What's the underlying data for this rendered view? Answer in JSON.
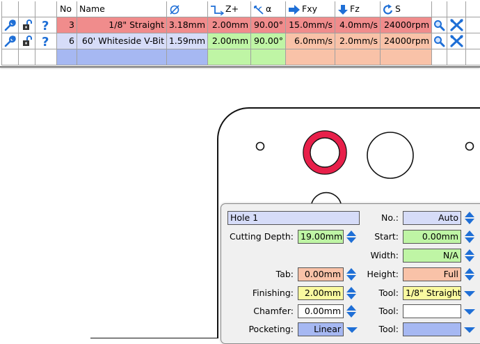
{
  "table": {
    "headers": {
      "no": "No",
      "name": "Name",
      "diameter_icon": "diameter-icon",
      "z_label": "Z+",
      "angle_label": "α",
      "fxy_label": "Fxy",
      "fz_label": "Fz",
      "s_label": "S"
    },
    "rows": [
      {
        "no": "3",
        "name": "1/8\" Straight",
        "diameter": "3.18mm",
        "z": "2.00mm",
        "angle": "90.00°",
        "fxy": "15.0mm/s",
        "fz": "4.0mm/s",
        "s": "24000rpm"
      },
      {
        "no": "6",
        "name": "60' Whiteside V-Bit",
        "diameter": "1.59mm",
        "z": "2.00mm",
        "angle": "90.00°",
        "fxy": "6.0mm/s",
        "fz": "2.0mm/s",
        "s": "24000rpm"
      }
    ]
  },
  "colors": {
    "row1": "#f08c8c",
    "row2": "#d6dcf8",
    "blue": "#a6b8f2",
    "green": "#bff5a5",
    "salmon": "#f9c2a8",
    "yellow": "#fafaa0",
    "selected_hole": "#e8204a",
    "icon_blue": "#1f6fd6"
  },
  "panel": {
    "name_value": "Hole 1",
    "cutting_depth": {
      "label": "Cutting Depth:",
      "value": "19.00mm"
    },
    "tab": {
      "label": "Tab:",
      "value": "0.00mm"
    },
    "finishing": {
      "label": "Finishing:",
      "value": "2.00mm"
    },
    "chamfer": {
      "label": "Chamfer:",
      "value": "0.00mm"
    },
    "pocketing": {
      "label": "Pocketing:",
      "value": "Linear"
    },
    "no": {
      "label": "No.:",
      "value": "Auto"
    },
    "start": {
      "label": "Start:",
      "value": "0.00mm"
    },
    "width": {
      "label": "Width:",
      "value": "N/A"
    },
    "height": {
      "label": "Height:",
      "value": "Full"
    },
    "tool1": {
      "label": "Tool:",
      "value": "1/8\" Straight"
    },
    "tool2": {
      "label": "Tool:",
      "value": ""
    },
    "tool3": {
      "label": "Tool:",
      "value": ""
    }
  }
}
